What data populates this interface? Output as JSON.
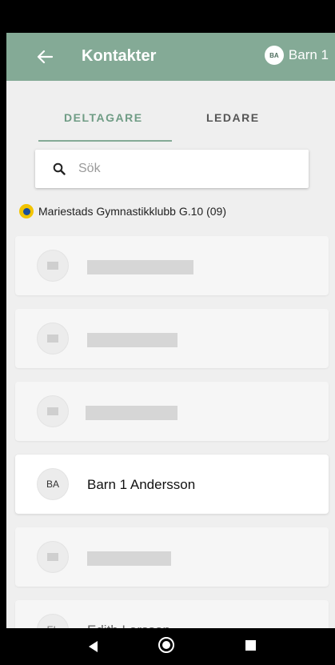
{
  "app_bar": {
    "title": "Kontakter",
    "account_initials": "BA",
    "account_name": "Barn 1"
  },
  "tabs": [
    {
      "label": "DELTAGARE",
      "selected": true
    },
    {
      "label": "LEDARE",
      "selected": false
    }
  ],
  "search": {
    "placeholder": "Sök",
    "value": ""
  },
  "club": {
    "name": "Mariestads Gymnastikklubb G.10 (09)"
  },
  "contacts": [
    {
      "initials": "",
      "name": "",
      "placeholder": true
    },
    {
      "initials": "",
      "name": "",
      "placeholder": true
    },
    {
      "initials": "",
      "name": "",
      "placeholder": true
    },
    {
      "initials": "BA",
      "name": "Barn 1 Andersson",
      "placeholder": false
    },
    {
      "initials": "",
      "name": "",
      "placeholder": true
    },
    {
      "initials": "EL",
      "name": "Edith Larsson",
      "placeholder": false
    }
  ],
  "colors": {
    "app_bar": "#84aa96",
    "accent": "#6f9c85"
  }
}
